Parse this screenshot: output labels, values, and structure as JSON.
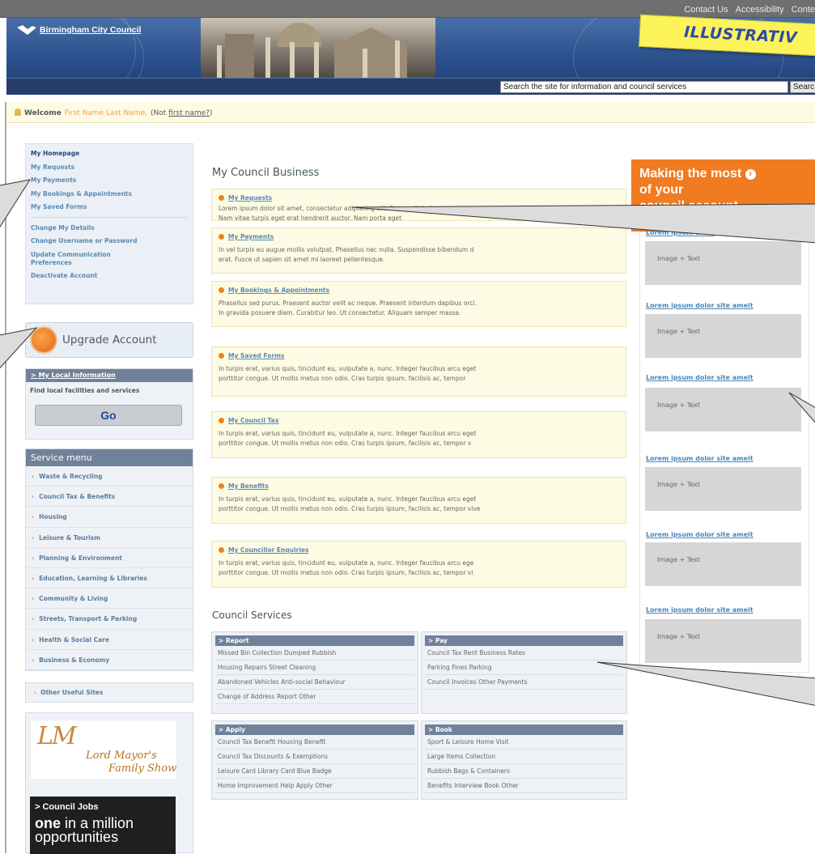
{
  "top_links": [
    "Contact Us",
    "Accessibility",
    "Conte"
  ],
  "logo_text": "Birmingham City Council",
  "illustrative_label": "ILLUSTRATIV",
  "search": {
    "value": "Search the site for information and council services",
    "button": "Searc"
  },
  "welcome": {
    "label": "Welcome",
    "name": "First Name Last Name,",
    "not_prefix": "(Not ",
    "not_link": "first name?",
    "not_suffix": ")"
  },
  "left_nav": {
    "group1": [
      "My Homepage",
      "My Requests",
      "My Payments",
      "My Bookings & Appointments",
      "My Saved Forms"
    ],
    "group2": [
      "Change My Details",
      "Change Username or Password",
      "Update Communication Preferences",
      "Deactivate Account"
    ]
  },
  "upgrade_label": "Upgrade Account",
  "local_info": {
    "header": "> My Local Information",
    "text": "Find local facilities and services",
    "button": "Go"
  },
  "service_menu": {
    "header": "Service menu",
    "items": [
      "Waste & Recycling",
      "Council Tax & Benefits",
      "Housing",
      "Leisure & Tourism",
      "Planning & Environment",
      "Education, Learning & Libraries",
      "Community & Living",
      "Streets, Transport & Parking",
      "Health & Social Care",
      "Business & Economy"
    ]
  },
  "other_sites": "Other Useful Sites",
  "lord_mayor": {
    "monogram": "LM",
    "line1": "Lord Mayor's",
    "line2": "Family Show"
  },
  "jobs": {
    "header": "> Council Jobs",
    "bold": "one",
    "rest": " in a million opportunities"
  },
  "my_council_business": {
    "title": "My Council Business",
    "boxes": [
      {
        "title": "My Requests",
        "line1": "Lorem ipsum dolor sit amet, consectetur adipiscing elit. Fusce adipiscing erat id lacus",
        "line2": "Nam vitae turpis eget erat hendrerit auctor. Nam porta eget"
      },
      {
        "title": "My Payments",
        "line1": "In vel turpis eu augue mollis volutpat. Phasellus nec nulla. Suspendisse bibendum d",
        "line2": "erat. Fusce ut sapien sit amet mi laoreet pellentesque."
      },
      {
        "title": "My Bookings & Appointments",
        "line1": "Phasellus sed purus. Praesent auctor velit ac neque. Praesent interdum dapibus orci.",
        "line2": "In gravida posuere diam. Curabitur leo. Ut consectetur. Aliquam semper massa."
      },
      {
        "title": "My Saved Forms",
        "line1": "In turpis erat, varius quis, tincidunt eu, vulputate a, nunc. Integer faucibus arcu eget",
        "line2": "porttitor congue. Ut mollis metus non odio. Cras turpis ipsum, facilisis ac, tempor"
      },
      {
        "title": "My Council Tax",
        "line1": "In turpis erat, varius quis, tincidunt eu, vulputate a, nunc. Integer faucibus arcu eget",
        "line2": "porttitor congue. Ut mollis metus non odio. Cras turpis ipsum, facilisis ac, tempor v"
      },
      {
        "title": "My Benefits",
        "line1": "In turpis erat, varius quis, tincidunt eu, vulputate a, nunc. Integer faucibus arcu eget",
        "line2": "porttitor congue. Ut mollis metus non odio. Cras turpis ipsum, facilisis ac, tempor vive"
      },
      {
        "title": "My Councillor Enquiries",
        "line1": "In turpis erat, varius quis, tincidunt eu, vulputate a, nunc. Integer faucibus arcu ege",
        "line2": "porttitor congue. Ut mollis metus non odio. Cras turpis ipsum, facilisis ac, tempor vi"
      }
    ]
  },
  "council_services": {
    "title": "Council Services",
    "report": {
      "header": "> Report",
      "rows": [
        "Missed Bin Collection  Dumped Rubbish",
        "Housing Repairs  Street Cleaning",
        "Abandoned Vehicles  Anti-social Behaviour",
        "Change of Address  Report Other"
      ]
    },
    "pay": {
      "header": "> Pay",
      "rows": [
        "Council Tax  Rent  Business Rates",
        "Parking Fines  Parking",
        "Council Invoices  Other Payments"
      ]
    },
    "apply": {
      "header": "> Apply",
      "rows": [
        "Council Tax Benefit  Housing Benefit",
        "Council Tax Discounts & Exemptions",
        "Leisure Card  Library Card  Blue Badge",
        "Home Improvement Help  Apply Other"
      ]
    },
    "book": {
      "header": "> Book",
      "rows": [
        "Sport & Leisure  Home Visit",
        "Large Items Collection",
        "Rubbish Bags & Containers",
        "Benefits Interview  Book Other"
      ]
    }
  },
  "making_most": {
    "line1": "Making the most",
    "line2": "of your",
    "line3": "council account"
  },
  "right_items": [
    {
      "link": "Lorem ipsum dolor",
      "img": "Image + Text"
    },
    {
      "link": "Lorem ipsum dolor site ameit",
      "img": "Image + Text"
    },
    {
      "link": "Lorem ipsum dolor site ameit",
      "img": "Image + Text"
    },
    {
      "link": "Lorem ipsum dolor site ameit",
      "img": "Image + Text"
    },
    {
      "link": "Lorem ipsum dolor site ameit",
      "img": "Image + Text"
    },
    {
      "link": "Lorem ipsum dolor site ameit",
      "img": "Image + Text"
    }
  ],
  "colors": {
    "accent_orange": "#f07b21",
    "header_blue": "#2e5490",
    "nav_link": "#5b8ab2",
    "box_bg": "#fdfbe3"
  }
}
